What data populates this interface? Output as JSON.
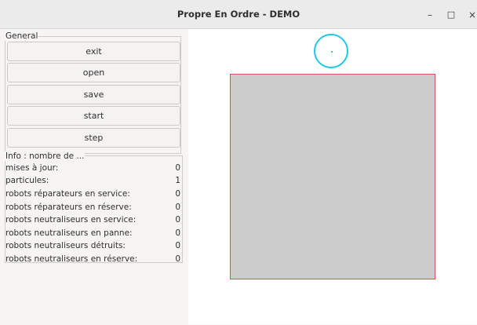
{
  "window": {
    "title": "Propre En Ordre - DEMO",
    "minimize_glyph": "–",
    "maximize_glyph": "□",
    "close_glyph": "×"
  },
  "general": {
    "legend": "General",
    "buttons": [
      "exit",
      "open",
      "save",
      "start",
      "step"
    ]
  },
  "info": {
    "legend": "Info : nombre de ...",
    "rows": [
      {
        "label": "mises à jour:",
        "value": "0"
      },
      {
        "label": "particules:",
        "value": "1"
      },
      {
        "label": "robots réparateurs en service:",
        "value": "0"
      },
      {
        "label": "robots réparateurs en réserve:",
        "value": "0"
      },
      {
        "label": "robots neutraliseurs en service:",
        "value": "0"
      },
      {
        "label": "robots neutraliseurs en panne:",
        "value": "0"
      },
      {
        "label": "robots neutraliseurs détruits:",
        "value": "0"
      },
      {
        "label": "robots neutraliseurs en réserve:",
        "value": "0"
      }
    ]
  },
  "canvas": {
    "robot_color": "#1ec8e6",
    "world_border_color": "#e05050",
    "world_fill_color": "#cccccc"
  }
}
